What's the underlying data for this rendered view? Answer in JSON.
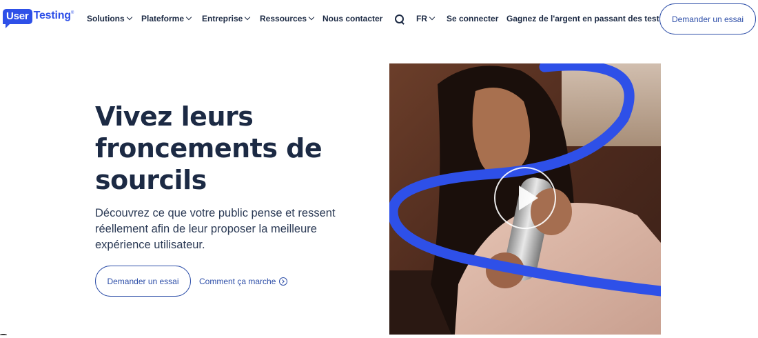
{
  "logo": {
    "part1": "User",
    "part2": "Testing",
    "reg": "®"
  },
  "nav": {
    "items": [
      {
        "label": "Solutions",
        "has_dropdown": true
      },
      {
        "label": "Plateforme",
        "has_dropdown": true
      },
      {
        "label": "Entreprise",
        "has_dropdown": true
      },
      {
        "label": "Ressources",
        "has_dropdown": true
      },
      {
        "label": "Nous contacter",
        "has_dropdown": false
      }
    ],
    "search_icon": "search-icon",
    "language": "FR",
    "login": "Se connecter",
    "earn": "Gagnez de l'argent en passant des tests",
    "cta": "Demander un essai"
  },
  "hero": {
    "title": "Vivez leurs froncements de sourcils",
    "description": "Découvrez ce que votre public pense et ressent réellement afin de leur proposer la meilleure expérience utilisateur.",
    "primary_cta": "Demander un essai",
    "secondary_cta": "Comment ça marche",
    "media_icon": "play-icon"
  },
  "colors": {
    "brand_blue": "#2e50e8",
    "text_dark": "#1c2a44",
    "button_blue": "#2d4ea8"
  }
}
